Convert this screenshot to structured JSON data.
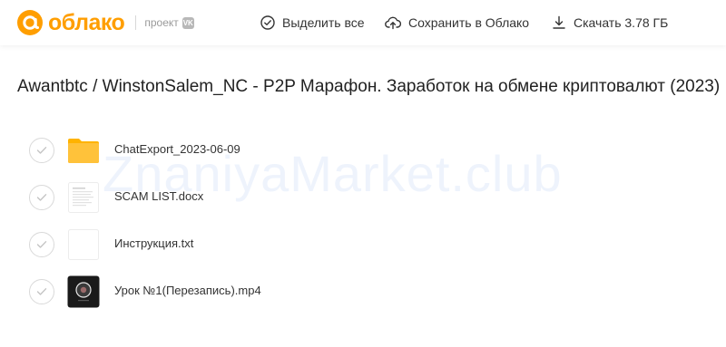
{
  "header": {
    "logo_text": "облако",
    "project_label": "проект",
    "vk_badge": "VK",
    "select_all_label": "Выделить все",
    "save_label": "Сохранить в Облако",
    "download_label": "Скачать 3.78 ГБ"
  },
  "title": "Awantbtc / WinstonSalem_NC - P2P Марафон. Заработок на обмене криптовалют (2023)",
  "files": [
    {
      "name": "ChatExport_2023-06-09",
      "type": "folder"
    },
    {
      "name": "SCAM LIST.docx",
      "type": "document"
    },
    {
      "name": "Инструкция.txt",
      "type": "text"
    },
    {
      "name": "Урок №1(Перезапись).mp4",
      "type": "video"
    }
  ],
  "watermark": "ZnaniyaMarket.club",
  "colors": {
    "brand": "#ff9e00",
    "folder": "#ffc23a"
  }
}
